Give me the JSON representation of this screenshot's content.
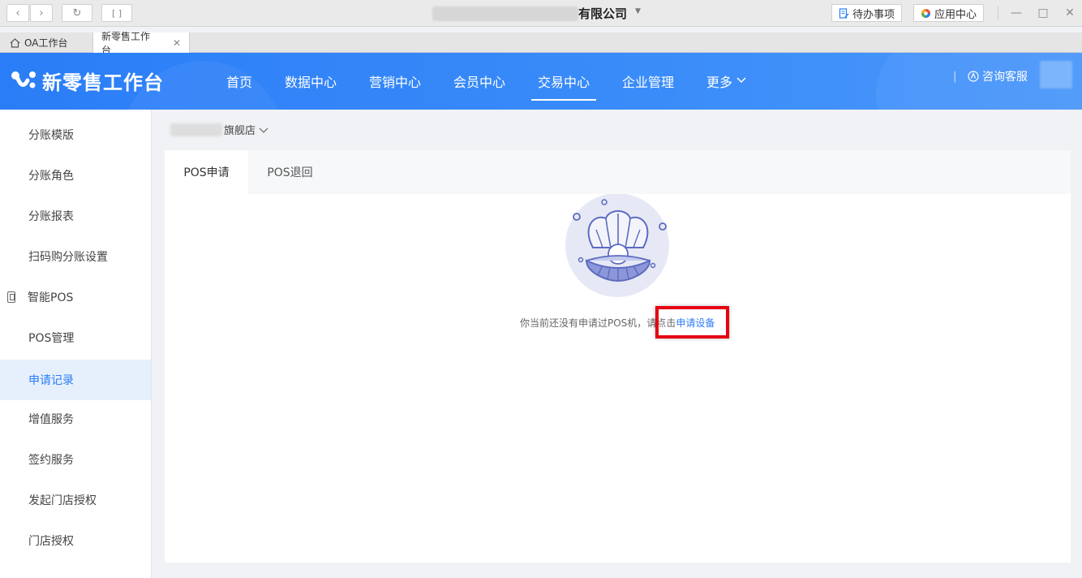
{
  "window": {
    "title": "有限公司",
    "todo_label": "待办事项",
    "app_center_label": "应用中心"
  },
  "tabs": [
    {
      "label": "OA工作台"
    },
    {
      "label": "新零售工作台"
    }
  ],
  "header": {
    "logo_text": "新零售工作台",
    "nav": [
      {
        "label": "首页"
      },
      {
        "label": "数据中心"
      },
      {
        "label": "营销中心"
      },
      {
        "label": "会员中心"
      },
      {
        "label": "交易中心"
      },
      {
        "label": "企业管理"
      },
      {
        "label": "更多"
      }
    ],
    "separator": "|",
    "support_label": "咨询客服"
  },
  "sidebar": {
    "items": [
      {
        "label": "分账模版"
      },
      {
        "label": "分账角色"
      },
      {
        "label": "分账报表"
      },
      {
        "label": "扫码购分账设置"
      },
      {
        "label": "智能POS"
      },
      {
        "label": "POS管理"
      },
      {
        "label": "申请记录"
      },
      {
        "label": "增值服务"
      },
      {
        "label": "签约服务"
      },
      {
        "label": "发起门店授权"
      },
      {
        "label": "门店授权"
      }
    ]
  },
  "store": {
    "name": "旗舰店"
  },
  "panel": {
    "tabs": [
      {
        "label": "POS申请"
      },
      {
        "label": "POS退回"
      }
    ],
    "empty_text": "你当前还没有申请过POS机，请点击",
    "empty_link": "申请设备"
  },
  "colors": {
    "accent": "#2b7df7",
    "highlight": "#e60012"
  }
}
